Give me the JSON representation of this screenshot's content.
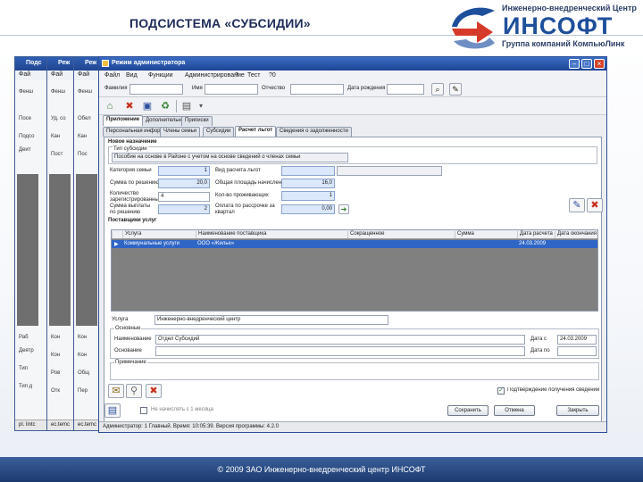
{
  "slide": {
    "title": "ПОДСИСТЕМА «СУБСИДИИ»",
    "footer": "© 2009 ЗАО Инженерно-внедренческий центр ИНСОФТ",
    "colors": {
      "brand": "#1e4f9b",
      "title_bar": "#1d4596",
      "selection": "#2f66c6",
      "footer": "#1c3a6f"
    }
  },
  "logo": {
    "top_text": "Инженерно-внедренческий Центр",
    "main_text": "ИНСОФТ",
    "bottom_text": "Группа компаний КомпьюЛинк"
  },
  "back_windows": [
    {
      "title": "Подс",
      "menu": "Фай",
      "lines": [
        "Фенш",
        "Посе",
        "Подсо",
        "Деит",
        "Раб",
        "Деятр",
        "Тип",
        "Тип д"
      ],
      "status": "pl. lintc"
    },
    {
      "title": "Реж",
      "menu": "Фай",
      "lines": [
        "Фенш",
        "Уд. со",
        "Кан",
        "Пост",
        "Кон",
        "Кон",
        "Ров",
        "Отк"
      ],
      "status": "ec.tеmc"
    },
    {
      "title": "Реж",
      "menu": "Фай",
      "lines": [
        "Фенш",
        "Обел",
        "Кан",
        "Пос",
        "Кон",
        "Кон",
        "Общ",
        "Пер"
      ],
      "status": "ec.tеmc"
    }
  ],
  "window": {
    "title": "Режим администратора",
    "menu": [
      "Файл",
      "Вид",
      "Функции",
      "Администрирование",
      "?",
      "Тест",
      "?0"
    ],
    "filter_labels": [
      "Фамилия",
      "Имя",
      "Отчество",
      "Дата рождения"
    ],
    "toolbar_icons": [
      "home-icon",
      "delete-icon",
      "save-icon",
      "refresh-icon",
      "print-icon",
      "arrow-icon"
    ],
    "tabs_top": [
      "Приложение",
      "Дополнительные",
      "Приписки"
    ],
    "tabs_sub": [
      "Персональная информация",
      "Члены семьи",
      "Субсидии",
      "Расчет льгот",
      "Сведения о задолженности"
    ],
    "active_sub_tab": 3
  },
  "form": {
    "subsidy_section": "Новое назначение",
    "group_label": "Тип субсидии",
    "type_value": "Пособие на основе в Районе с учетом на основе сведений о членах семьи",
    "fields_left": [
      {
        "label": "Категория семьи",
        "value": "1"
      },
      {
        "label": "Сумма по решению",
        "value": "20,0"
      },
      {
        "label": "Количество зарегистрированных",
        "value": "4"
      },
      {
        "label": "Сумма выплаты по решению",
        "value": "2"
      }
    ],
    "fields_mid": [
      {
        "label": "Вид расчета льгот",
        "value": ""
      },
      {
        "label": "Общая площадь начисления",
        "value": ""
      },
      {
        "label": "Кол-во проживающих",
        "value": ""
      },
      {
        "label": "Оплата по рассрочке за квартал",
        "value": ""
      }
    ],
    "fields_right": [
      {
        "value": ""
      },
      {
        "value": "16,0"
      },
      {
        "value": "1"
      },
      {
        "value": "0,00"
      }
    ],
    "services_section": "Поставщики услуг",
    "grid": {
      "columns": [
        "Услуга",
        "Наименование поставщика",
        "Сокращенное",
        "Сумма",
        "Дата расчета",
        "Дата окончания"
      ],
      "rows": [
        {
          "service": "Коммунальные услуги",
          "provider": "ООО «Жилье»",
          "short": "",
          "amount": "",
          "date1": "24.03.2009",
          "date2": ""
        }
      ]
    },
    "lower": {
      "service_label": "Услуга",
      "service_value": "Инженерно-внедренческий центр",
      "group1_label": "Основные",
      "name_label": "Наименование",
      "name_value": "Отдел Субсидий",
      "note_label": "Основание",
      "date_label": "Дата с",
      "date_value": "24.03.2009",
      "date2_label": "Дата по",
      "group2_label": "Примечание"
    },
    "checkbox_bottom": "Подтверждение получения сведений о доходах",
    "checkbox_left": "Не начислять с 1 месяца",
    "buttons": [
      "Сохранить",
      "Отмена",
      "Закрыть"
    ],
    "status": "Администратор: 1 Главный. Время: 10:05:39. Версия программы: 4.2.0"
  }
}
